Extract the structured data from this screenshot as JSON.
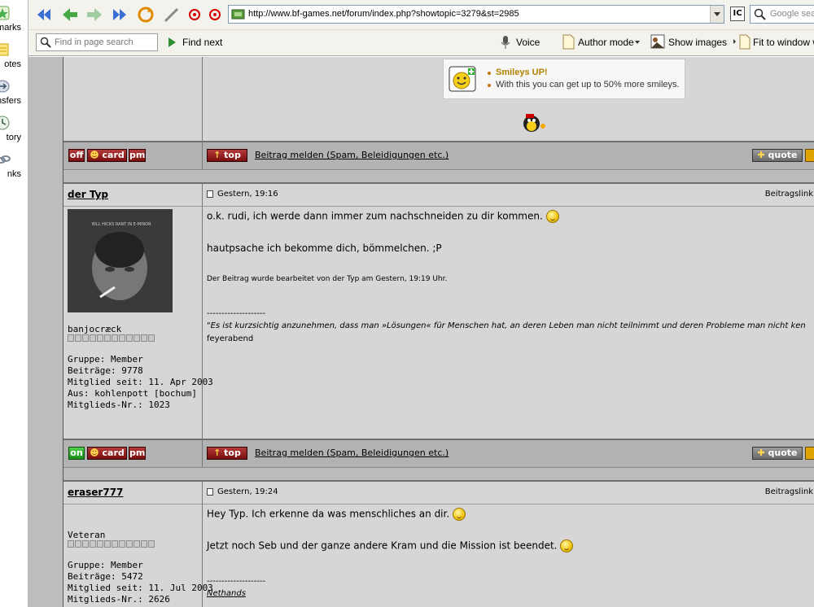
{
  "sidebar": {
    "items": [
      {
        "label": "okmarks",
        "icon": "star-icon"
      },
      {
        "label": "otes",
        "icon": "notes-icon"
      },
      {
        "label": "nsfers",
        "icon": "transfers-icon"
      },
      {
        "label": "tory",
        "icon": "history-icon"
      },
      {
        "label": "nks",
        "icon": "links-icon"
      }
    ]
  },
  "toolbar": {
    "url": "http://www.bf-games.net/forum/index.php?showtopic=3279&st=2985",
    "search_placeholder": "Google sea",
    "find_placeholder": "Find in page search",
    "find_next": "Find next",
    "voice": "Voice",
    "author_mode": "Author mode",
    "show_images": "Show images",
    "fit_to_window": "Fit to window w"
  },
  "ad": {
    "title": "Smileys UP!",
    "text": "With this you can get up to 50% more smileys."
  },
  "buttons": {
    "off": "off",
    "on": "on",
    "card": "card",
    "pm": "pm",
    "top": "top",
    "quote": "quote",
    "report": "Beitrag melden (Spam, Beleidigungen etc.)"
  },
  "posts": [
    {
      "username": "der Typ",
      "date": "Gestern, 19:16",
      "link": "Beitragslink",
      "rank": "banjocræck",
      "group": "Gruppe: Member",
      "posts": "Beiträge: 9778",
      "since": "Mitglied seit: 11. Apr 2003",
      "from": "Aus: kohlenpott [bochum]",
      "member_no": "Mitglieds-Nr.: 1023",
      "avatar_text": "BILL HICKS RANT IN E-MINOR",
      "line1": "o.k. rudi, ich werde dann immer zum nachschneiden zu dir kommen.",
      "line2": "hautpsache ich bekomme dich, bömmelchen. ;P",
      "edited": "Der Beitrag wurde bearbeitet von der Typ am Gestern, 19:19 Uhr.",
      "sig_sep": "--------------------",
      "sig_quote": "\"Es ist kurzsichtig anzunehmen, dass man »Lösungen« für Menschen hat, an deren Leben man nicht teilnimmt und deren Probleme man nicht ken",
      "sig_author": "feyerabend"
    },
    {
      "username": "eraser777",
      "date": "Gestern, 19:24",
      "link": "Beitragslink",
      "rank": "Veteran",
      "group": "Gruppe: Member",
      "posts": "Beiträge: 5472",
      "since": "Mitglied seit: 11. Jul 2003",
      "member_no": "Mitglieds-Nr.: 2626",
      "line1": "Hey Typ. Ich erkenne da was menschliches an dir.",
      "line2": "Jetzt noch Seb und der ganze andere Kram und die Mission ist beendet.",
      "sig_sep": "--------------------",
      "sig_author": "Nethands"
    }
  ]
}
